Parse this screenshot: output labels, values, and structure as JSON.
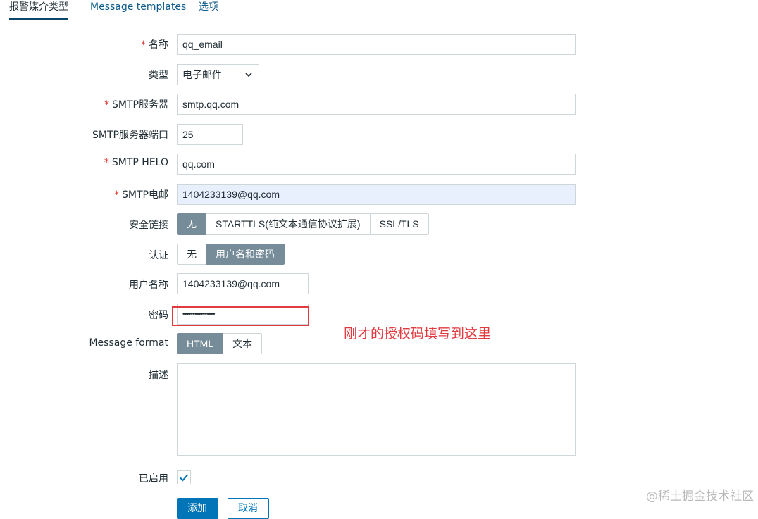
{
  "tabs": [
    {
      "label": "报警媒介类型",
      "active": true
    },
    {
      "label": "Message templates",
      "active": false
    },
    {
      "label": "选项",
      "active": false
    }
  ],
  "form": {
    "required_mark": "*",
    "name": {
      "label": "名称",
      "value": "qq_email"
    },
    "type": {
      "label": "类型",
      "value": "电子邮件"
    },
    "smtp_server": {
      "label": "SMTP服务器",
      "value": "smtp.qq.com"
    },
    "smtp_port": {
      "label": "SMTP服务器端口",
      "value": "25"
    },
    "smtp_helo": {
      "label": "SMTP HELO",
      "value": "qq.com"
    },
    "smtp_email": {
      "label": "SMTP电邮",
      "value": "1404233139@qq.com"
    },
    "security": {
      "label": "安全链接",
      "options": [
        "无",
        "STARTTLS(纯文本通信协议扩展)",
        "SSL/TLS"
      ],
      "selected": "无"
    },
    "auth": {
      "label": "认证",
      "options": [
        "无",
        "用户名和密码"
      ],
      "selected": "用户名和密码"
    },
    "username": {
      "label": "用户名称",
      "value": "1404233139@qq.com"
    },
    "password": {
      "label": "密码",
      "value": "••••••••••••••••"
    },
    "message_format": {
      "label": "Message format",
      "options": [
        "HTML",
        "文本"
      ],
      "selected": "HTML"
    },
    "description": {
      "label": "描述",
      "value": ""
    },
    "enabled": {
      "label": "已启用",
      "checked": true
    }
  },
  "buttons": {
    "add": "添加",
    "cancel": "取消"
  },
  "annotation": "刚才的授权码填写到这里",
  "watermark": "@稀土掘金技术社区",
  "colors": {
    "accent": "#0275b8",
    "selected_segment": "#768d99",
    "annotation": "#e0393e",
    "required": "#e33734",
    "autofill": "#e8f0fe"
  }
}
